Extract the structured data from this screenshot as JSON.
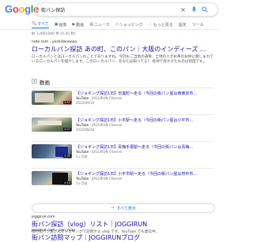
{
  "search": {
    "query": "街パン探訪"
  },
  "logo": "Google",
  "tabs": [
    {
      "label": "すべて",
      "icon": "search-icon"
    },
    {
      "label": "画像",
      "icon": "image-icon"
    },
    {
      "label": "動画",
      "icon": "video-icon"
    },
    {
      "label": "ニュース",
      "icon": "news-icon"
    },
    {
      "label": "ショッピング",
      "icon": "tag-icon"
    },
    {
      "label": "もっと見る",
      "icon": "more-icon"
    },
    {
      "label": "設定",
      "icon": ""
    },
    {
      "label": "ツール",
      "icon": ""
    }
  ],
  "stats": "約 1,490,000 件 (0.45 秒)",
  "results": [
    {
      "url": "note.com › yoshidanoooo",
      "title": "ローカルパン探訪 あの町、このパン｜大阪のインディーズ ...",
      "snippet": "ローカルパンとはローカルパンのことでありますね。今回もご当地の通称、土地の人がお茶のお供に親しまれているローカルパンを紹介します。このローカルパン、あなたは知ってる？ 各地で見かけたものは何度でも。"
    }
  ],
  "videos": {
    "heading": "動画",
    "items": [
      {
        "title": "【ジョギング探訪1日】日進町〜走る（今回の街パン屋は西東京市...",
        "channel": "YouTube",
        "channel_name": "JOGGIRUN Channel",
        "date": "2022/09/19",
        "duration": "3:51"
      },
      {
        "title": "【ジョギング探訪1日】小平駅〜走る（今回の街パン屋は小平市...",
        "channel": "YouTube",
        "channel_name": "JOGGIRUN Channel",
        "date": "2022/08/28",
        "duration": "4:07"
      },
      {
        "title": "【ジョギング探訪1日】青梅手振駅〜走る（今回の街パンは青梅...",
        "channel": "YouTube",
        "channel_name": "JOGGIRUN Channel",
        "date": "1ヶ月前",
        "duration": "3:35"
      },
      {
        "title": "【ジョギング探訪1日】小平市駅〜走る（今回の街パン屋は府中市...",
        "channel": "YouTube",
        "channel_name": "JOGGIRUN Channel",
        "date": "1ヶ月前",
        "duration": "4:14"
      }
    ],
    "more_label": "すべて表示"
  },
  "bottom_results": [
    {
      "url": "joggirun.com",
      "title": "街パン探訪（vlog）リスト｜JOGGIRUN",
      "snippet": "街と街パン屋さんをジョギングで訪問する vlog です。YouTube でも発信中。"
    },
    {
      "url": "joggirun.com › pan_map",
      "title": "街パン訪問マップ｜JOGGIRUNブログ",
      "snippet": ""
    }
  ],
  "colors": {
    "link": "#1a0dab",
    "accent": "#1a73e8"
  }
}
